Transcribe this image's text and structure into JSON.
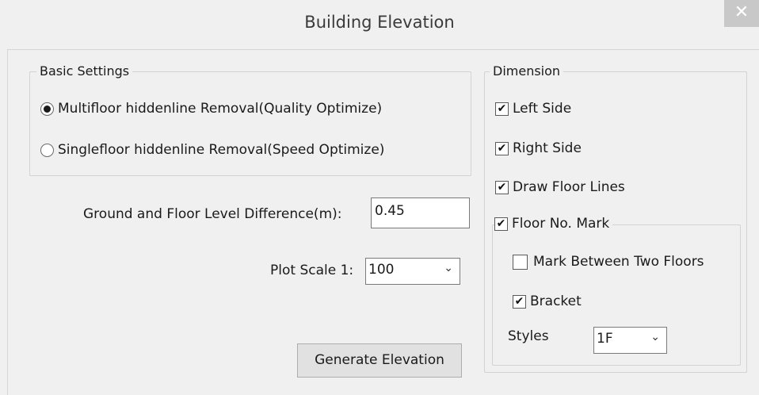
{
  "window": {
    "title": "Building Elevation",
    "close_label": "✕"
  },
  "basic_settings": {
    "legend": "Basic Settings",
    "options": [
      {
        "label": "Multifloor hiddenline Removal(Quality Optimize)",
        "selected": true
      },
      {
        "label": "Singlefloor hiddenline Removal(Speed Optimize)",
        "selected": false
      }
    ]
  },
  "ground_floor": {
    "label": "Ground and Floor Level Difference(m):",
    "value": "0.45"
  },
  "plot_scale": {
    "label": "Plot Scale  1:",
    "value": "100"
  },
  "generate_button": "Generate Elevation",
  "dimension": {
    "legend": "Dimension",
    "left_side": {
      "label": "Left Side",
      "checked": true
    },
    "right_side": {
      "label": "Right Side",
      "checked": true
    },
    "draw_floor_lines": {
      "label": "Draw Floor Lines",
      "checked": true
    },
    "floor_no_mark": {
      "label": "Floor No. Mark",
      "checked": true,
      "mark_between": {
        "label": "Mark Between Two Floors",
        "checked": false
      },
      "bracket": {
        "label": "Bracket",
        "checked": true
      },
      "styles": {
        "label": "Styles",
        "value": "1F"
      }
    }
  },
  "icons": {
    "check": "checkmark-icon",
    "dropdown": "chevron-down-icon",
    "close": "close-icon"
  }
}
